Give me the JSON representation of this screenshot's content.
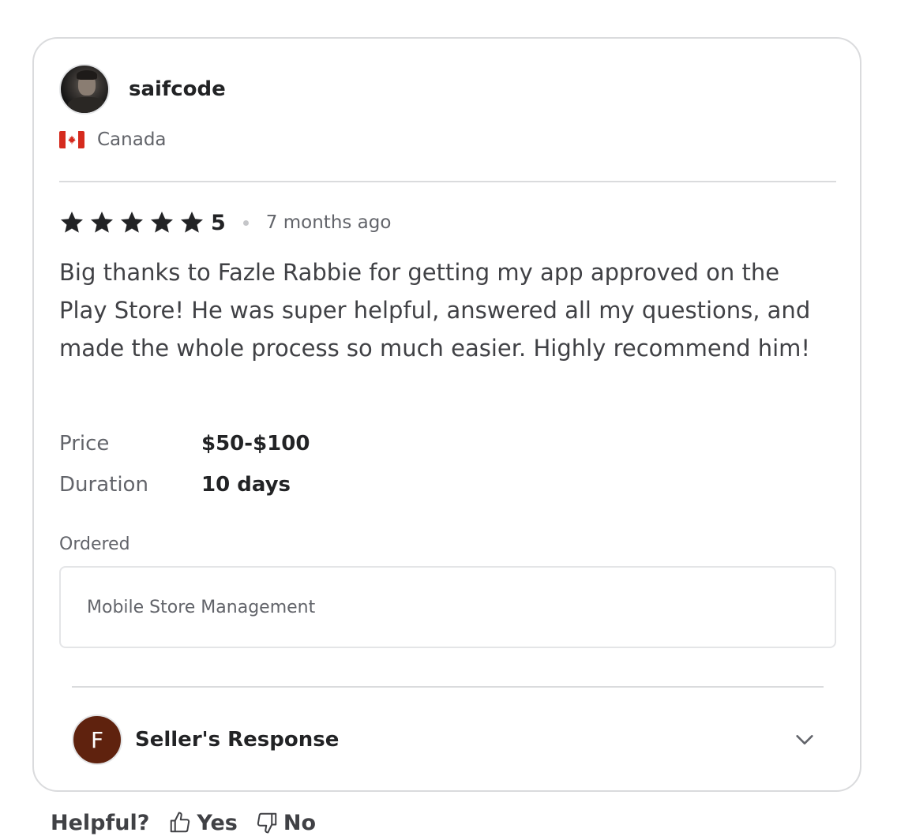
{
  "reviewer": {
    "username": "saifcode",
    "avatar_icon": "user-photo",
    "country": "Canada",
    "country_flag": "canada-flag-icon"
  },
  "review": {
    "rating": 5,
    "score_label": "5",
    "time_ago": "7 months ago",
    "text": "Big thanks to Fazle Rabbie for getting my app approved on the Play Store! He was super helpful, answered all my questions, and made the whole process so much easier. Highly recommend him!"
  },
  "meta": {
    "price_label": "Price",
    "price_value": "$50-$100",
    "duration_label": "Duration",
    "duration_value": "10 days"
  },
  "ordered": {
    "label": "Ordered",
    "item": "Mobile Store Management"
  },
  "seller_response": {
    "initial": "F",
    "label": "Seller's Response",
    "avatar_color": "#5f220e"
  },
  "helpful": {
    "label": "Helpful?",
    "yes_label": "Yes",
    "no_label": "No"
  },
  "colors": {
    "star": "#222325",
    "border": "#dadbdd",
    "muted_text": "#62646a"
  }
}
